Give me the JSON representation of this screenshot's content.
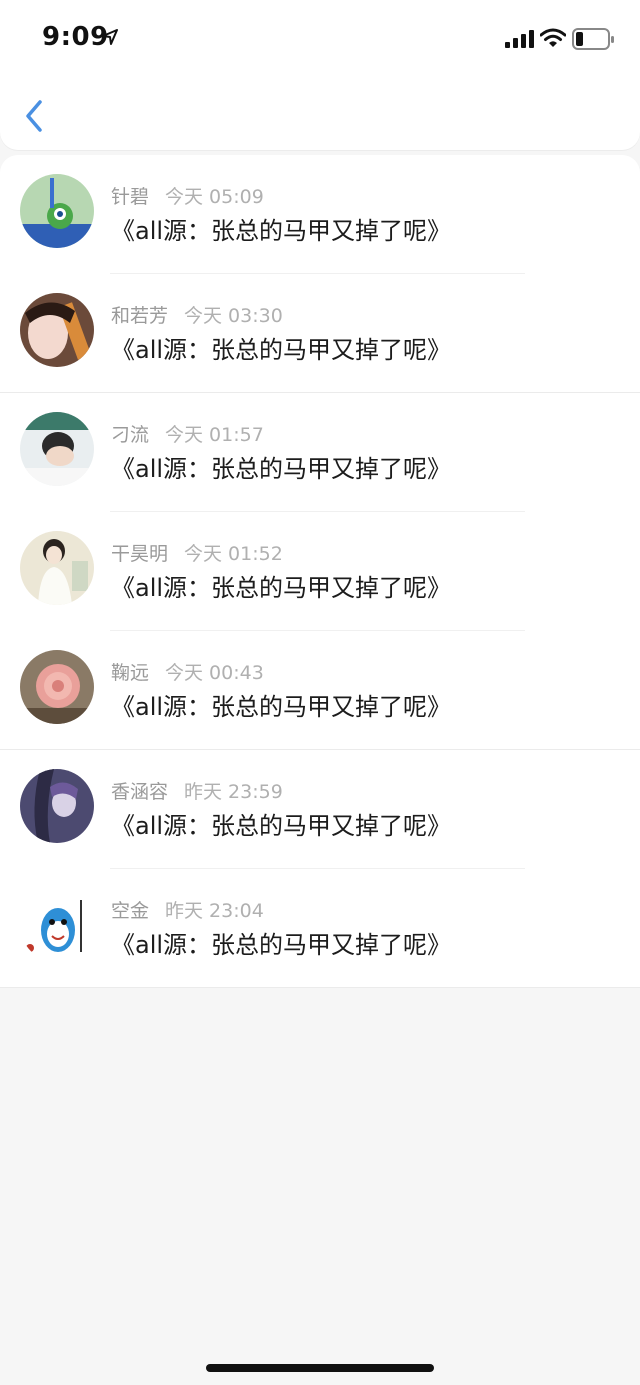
{
  "status_bar": {
    "time": "9:09"
  },
  "header": {
    "back_icon": "chevron-left-icon",
    "accent_color": "#4a90e2"
  },
  "messages": [
    {
      "name": "针碧",
      "time": "今天 05:09",
      "text": "《all源：张总的马甲又掉了呢》"
    },
    {
      "name": "和若芳",
      "time": "今天 03:30",
      "text": "《all源：张总的马甲又掉了呢》"
    },
    {
      "name": "刁流",
      "time": "今天 01:57",
      "text": "《all源：张总的马甲又掉了呢》"
    },
    {
      "name": "干昊明",
      "time": "今天 01:52",
      "text": "《all源：张总的马甲又掉了呢》"
    },
    {
      "name": "鞠远",
      "time": "今天 00:43",
      "text": "《all源：张总的马甲又掉了呢》"
    },
    {
      "name": "香涵容",
      "time": "昨天 23:59",
      "text": "《all源：张总的马甲又掉了呢》"
    },
    {
      "name": "空金",
      "time": "昨天 23:04",
      "text": "《all源：张总的马甲又掉了呢》"
    }
  ]
}
